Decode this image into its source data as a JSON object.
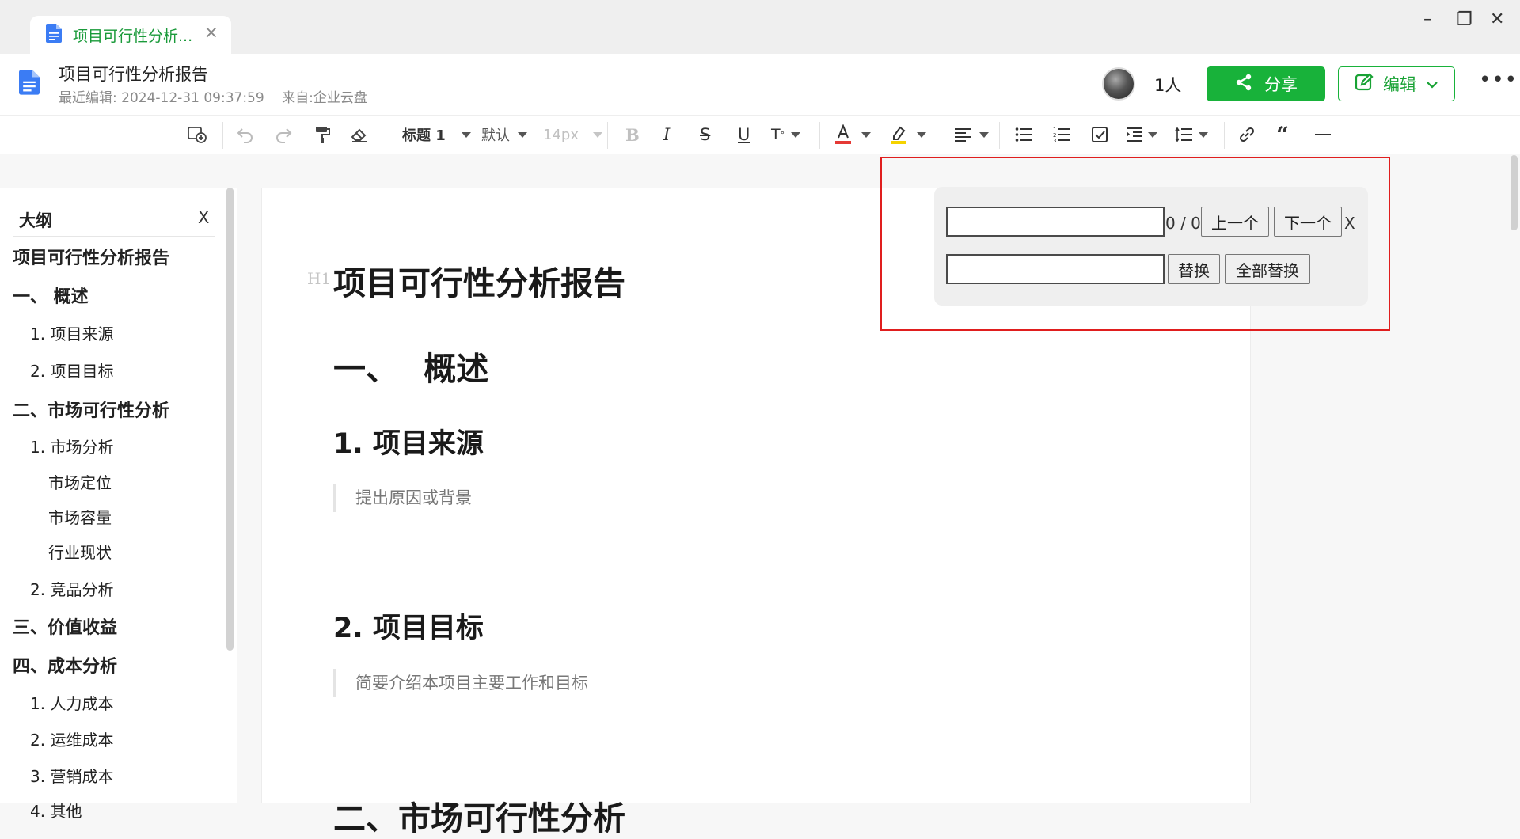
{
  "tab": {
    "title": "项目可行性分析...",
    "close": "×"
  },
  "window": {
    "minimize": "–",
    "restore": "❐",
    "close": "✕"
  },
  "header": {
    "title": "项目可行性分析报告",
    "last_edited_label": "最近编辑:",
    "last_edited_value": "2024-12-31 09:37:59",
    "source_label": "来自:",
    "source_value": "企业云盘",
    "people_count": "1人",
    "share_label": "分享",
    "edit_label": "编辑",
    "more": "•••"
  },
  "toolbar": {
    "heading_style": "标题 1",
    "font_family": "默认",
    "font_size": "14px",
    "text_color": "#e53935",
    "highlight_color": "#f5d300",
    "icons": [
      "comment-add-icon",
      "undo-icon",
      "redo-icon",
      "format-painter-icon",
      "eraser-icon",
      "bold-icon",
      "italic-icon",
      "strikethrough-icon",
      "underline-icon",
      "superscript-icon",
      "font-color-icon",
      "highlight-icon",
      "align-icon",
      "bullet-list-icon",
      "numbered-list-icon",
      "checklist-icon",
      "indent-icon",
      "line-height-icon",
      "link-icon",
      "quote-icon",
      "divider-icon"
    ]
  },
  "outline": {
    "title": "大纲",
    "close": "X",
    "items": [
      {
        "label": "项目可行性分析报告",
        "level": 0
      },
      {
        "label": "一、 概述",
        "level": 1
      },
      {
        "label": "1. 项目来源",
        "level": 2
      },
      {
        "label": "2. 项目目标",
        "level": 2
      },
      {
        "label": "二、市场可行性分析",
        "level": 1
      },
      {
        "label": "1. 市场分析",
        "level": 2
      },
      {
        "label": "市场定位",
        "level": 3
      },
      {
        "label": "市场容量",
        "level": 3
      },
      {
        "label": "行业现状",
        "level": 3
      },
      {
        "label": "2. 竞品分析",
        "level": 2
      },
      {
        "label": "三、价值收益",
        "level": 1
      },
      {
        "label": "四、成本分析",
        "level": 1
      },
      {
        "label": "1. 人力成本",
        "level": 2
      },
      {
        "label": "2. 运维成本",
        "level": 2
      },
      {
        "label": "3. 营销成本",
        "level": 2
      },
      {
        "label": "4. 其他",
        "level": 2
      }
    ]
  },
  "document": {
    "heading_marker": "H1",
    "title": "项目可行性分析报告",
    "section1": "一、 概述",
    "sub1": "1. 项目来源",
    "quote1": "提出原因或背景",
    "sub2": "2. 项目目标",
    "quote2": "简要介绍本项目主要工作和目标",
    "section2_partial": "二、市场可行性分析"
  },
  "find_replace": {
    "find_value": "",
    "replace_value": "",
    "count": "0 / 0",
    "prev_label": "上一个",
    "next_label": "下一个",
    "close_label": "X",
    "replace_label": "替换",
    "replace_all_label": "全部替换"
  },
  "colors": {
    "brand_green": "#18b23a",
    "highlight_frame": "#e01e1e"
  }
}
